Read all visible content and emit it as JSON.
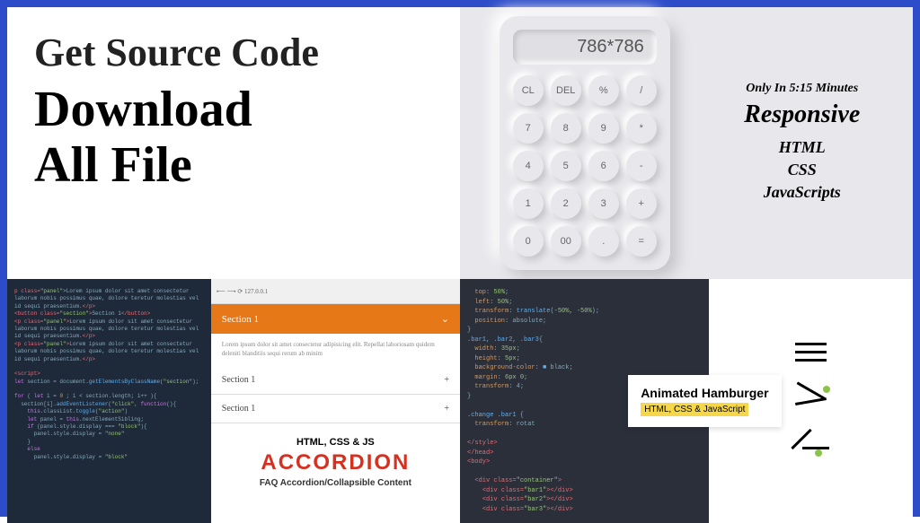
{
  "title": {
    "line1": "Get Source Code",
    "line2a": "Download",
    "line2b": "All File"
  },
  "calculator": {
    "display": "786*786",
    "buttons": [
      "CL",
      "DEL",
      "%",
      "/",
      "7",
      "8",
      "9",
      "*",
      "4",
      "5",
      "6",
      "-",
      "1",
      "2",
      "3",
      "+",
      "0",
      "00",
      ".",
      "="
    ],
    "heading1": "Only In 5:15 Minutes",
    "heading2": "Responsive",
    "tech1": "HTML",
    "tech2": "CSS",
    "tech3": "JavaScripts"
  },
  "accordion": {
    "sections": [
      "Section 1",
      "Section 1",
      "Section 1"
    ],
    "t1": "HTML, CSS & JS",
    "t2": "ACCORDION",
    "t3": "FAQ Accordion/Collapsible Content"
  },
  "hamburger": {
    "label1": "Animated Hamburger",
    "label2": "HTML, CSS & JavaScript"
  },
  "code_samples": {
    "accordion_code": "p class=\"panel\">Lorem ipsum dolor sit amet\nlaborum nobis possimus quae, dolore teretur\nid sequi praesentium.</p>\n<button class=\"section\">Section 1</button>\n<p class=\"panel\">Lorem ipsum dolor sit amet\nlaborum nobis possimus quae, dolore teretur\nid sequi praesentium.</p>\n<p class=\"panel\">Lorem ipsum dolor sit amet\nlaborum nobis possimus quae, dolore teretur\nid sequi praesentium.</p>\n\n<script>\nlet section = document.getElementsByClassName(\"section\");\n\nfor ( let i = 0; i < section.length; i++ ){\n  section[i].addEventListener(\"click\", function(){\n    this.classList.toggle(\"action\");\n    let panel = this.nextElementSibling;\n    if (panel.style.display === \"block\"){\n      panel.style.display = \"none\"\n    }\n    else{\n      panel.style.display = \"block\"\n",
    "hamburger_code": "top: 50%;\nleft: 50%;\ntransform: translate(-50%, -50%);\nposition: absolute;\n}\n.bar1, .bar2, .bar3{\nwidth: 35px;\nheight: 5px;\nbackground-color: black;\nmargin: 6px 0;\ntransform: 4;\n}\n\n.change .bar1 {\ntransform: rotat\n\n</style>\n</head>\n<body>\n\n<div class=\"container\">\n<div class=\"bar1\"></div>\n<div class=\"bar2\"></div>\n<div class=\"bar3\"></div>"
  }
}
